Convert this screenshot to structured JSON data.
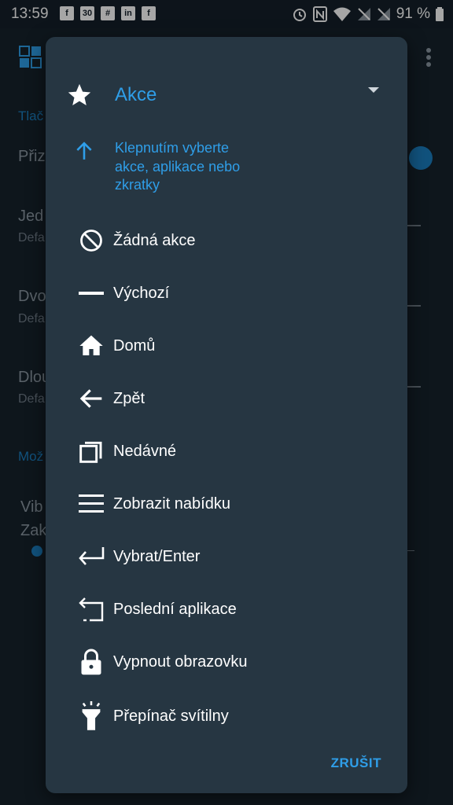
{
  "status_bar": {
    "time": "13:59",
    "left_icons": [
      "facebook-icon",
      "calendar-icon",
      "slack-icon",
      "linkedin-icon",
      "facebook-icon"
    ],
    "calendar_day": "30",
    "battery_text": "91 %"
  },
  "background": {
    "section1_header": "Tlač",
    "row1_title": "Přiz",
    "row2_title": "Jed",
    "row2_sub": "Defa",
    "row3_title": "Dvo",
    "row3_sub": "Defa",
    "row4_title": "Dlou",
    "row4_sub": "Defa",
    "section2_header": "Mož",
    "row5_title": "Vib",
    "row5_sub": "Zak"
  },
  "dialog": {
    "title": "Akce",
    "hint": "Klepnutím vyberte akce, aplikace nebo zkratky",
    "items": [
      {
        "label": "Žádná akce",
        "icon": "block-icon"
      },
      {
        "label": "Výchozí",
        "icon": "minus-icon"
      },
      {
        "label": "Domů",
        "icon": "home-icon"
      },
      {
        "label": "Zpět",
        "icon": "arrow-back-icon"
      },
      {
        "label": "Nedávné",
        "icon": "recents-icon"
      },
      {
        "label": "Zobrazit nabídku",
        "icon": "menu-icon"
      },
      {
        "label": "Vybrat/Enter",
        "icon": "enter-icon"
      },
      {
        "label": "Poslední aplikace",
        "icon": "last-app-icon"
      },
      {
        "label": "Vypnout obrazovku",
        "icon": "lock-icon"
      },
      {
        "label": "Přepínač svítilny",
        "icon": "flashlight-icon"
      }
    ],
    "cancel_label": "ZRUŠIT"
  },
  "colors": {
    "accent": "#2f9ee8",
    "dialog_bg": "#263642",
    "screen_bg": "#14202a"
  }
}
